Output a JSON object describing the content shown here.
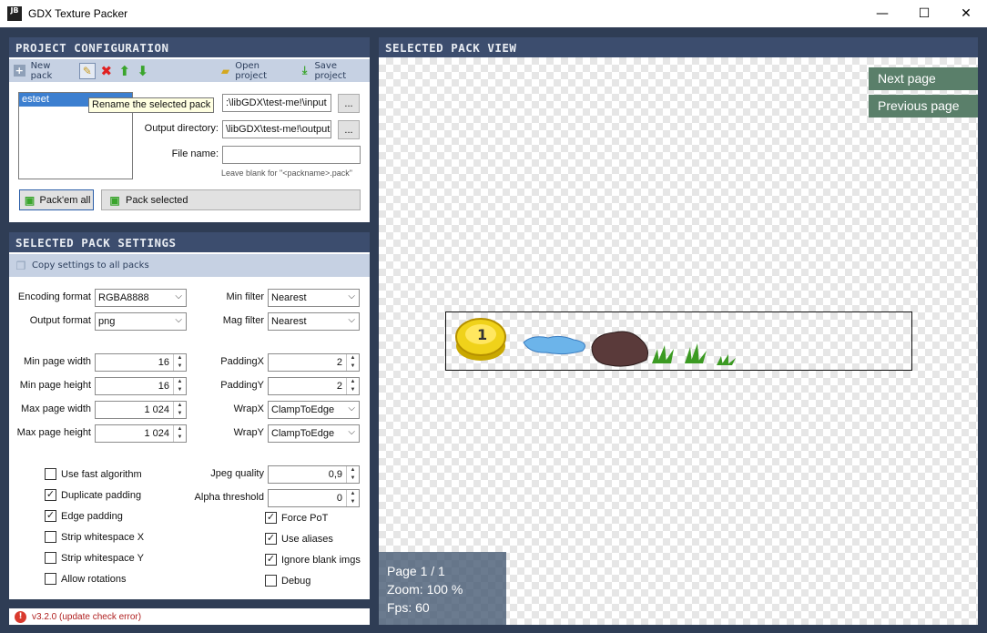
{
  "window": {
    "title": "GDX Texture Packer",
    "minimize": "—",
    "maximize": "☐",
    "close": "✕"
  },
  "project": {
    "header": "PROJECT CONFIGURATION",
    "toolbar": {
      "new_pack": "New pack",
      "open_project": "Open project",
      "save_project": "Save project"
    },
    "packs": [
      "esteet"
    ],
    "tooltip": "Rename the selected pack",
    "input_dir_value": ":\\libGDX\\test-me!\\input",
    "output_dir_label": "Output directory:",
    "output_dir_value": "\\libGDX\\test-me!\\output",
    "browse": "...",
    "file_name_label": "File name:",
    "file_name_value": "",
    "file_name_hint": "Leave blank for \"<packname>.pack\"",
    "pack_all": "Pack'em all",
    "pack_selected": "Pack selected"
  },
  "settings": {
    "header": "SELECTED PACK SETTINGS",
    "copy_settings": "Copy settings to all packs",
    "encoding_format": {
      "label": "Encoding format",
      "value": "RGBA8888"
    },
    "output_format": {
      "label": "Output format",
      "value": "png"
    },
    "min_filter": {
      "label": "Min filter",
      "value": "Nearest"
    },
    "mag_filter": {
      "label": "Mag filter",
      "value": "Nearest"
    },
    "min_page_width": {
      "label": "Min page width",
      "value": "16"
    },
    "min_page_height": {
      "label": "Min page height",
      "value": "16"
    },
    "max_page_width": {
      "label": "Max page width",
      "value": "1 024"
    },
    "max_page_height": {
      "label": "Max page height",
      "value": "1 024"
    },
    "padding_x": {
      "label": "PaddingX",
      "value": "2"
    },
    "padding_y": {
      "label": "PaddingY",
      "value": "2"
    },
    "wrap_x": {
      "label": "WrapX",
      "value": "ClampToEdge"
    },
    "wrap_y": {
      "label": "WrapY",
      "value": "ClampToEdge"
    },
    "jpeg_quality": {
      "label": "Jpeg quality",
      "value": "0,9"
    },
    "alpha_threshold": {
      "label": "Alpha threshold",
      "value": "0"
    },
    "checks_left": [
      {
        "label": "Use fast algorithm",
        "checked": false
      },
      {
        "label": "Duplicate padding",
        "checked": true
      },
      {
        "label": "Edge padding",
        "checked": true
      },
      {
        "label": "Strip whitespace X",
        "checked": false
      },
      {
        "label": "Strip whitespace Y",
        "checked": false
      },
      {
        "label": "Allow rotations",
        "checked": false
      }
    ],
    "checks_right": [
      {
        "label": "Force PoT",
        "checked": true
      },
      {
        "label": "Use aliases",
        "checked": true
      },
      {
        "label": "Ignore blank imgs",
        "checked": true
      },
      {
        "label": "Debug",
        "checked": false
      }
    ]
  },
  "status": {
    "text": "v3.2.0 (update check error)"
  },
  "view": {
    "header": "SELECTED PACK VIEW",
    "next_page": "Next page",
    "previous_page": "Previous page",
    "page": "Page 1 / 1",
    "zoom": "Zoom: 100 %",
    "fps": "Fps: 60"
  },
  "colors": {
    "header_bg": "#3c4d6e",
    "toolbar_bg": "#c6d1e3",
    "app_bg": "#2f3d55",
    "page_button": "#5a7f6a"
  }
}
